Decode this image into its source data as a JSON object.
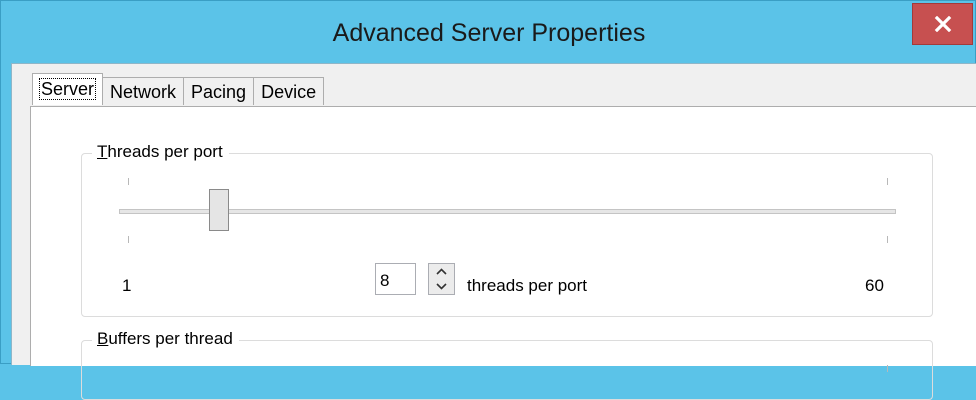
{
  "window": {
    "title": "Advanced Server Properties",
    "close_label": "x"
  },
  "tabs": [
    {
      "label": "Server",
      "active": true
    },
    {
      "label": "Network",
      "active": false
    },
    {
      "label": "Pacing",
      "active": false
    },
    {
      "label": "Device",
      "active": false
    }
  ],
  "threads_group": {
    "label_accel": "T",
    "label_rest": "hreads per port",
    "slider": {
      "min": 1,
      "max": 60,
      "value": 8
    },
    "min_label": "1",
    "max_label": "60",
    "spin_value": "8",
    "unit_label": "threads per port"
  },
  "buffers_group": {
    "label_accel": "B",
    "label_rest": "uffers per thread"
  },
  "colors": {
    "title_bar": "#5bc3e8",
    "close_button": "#c75050"
  }
}
